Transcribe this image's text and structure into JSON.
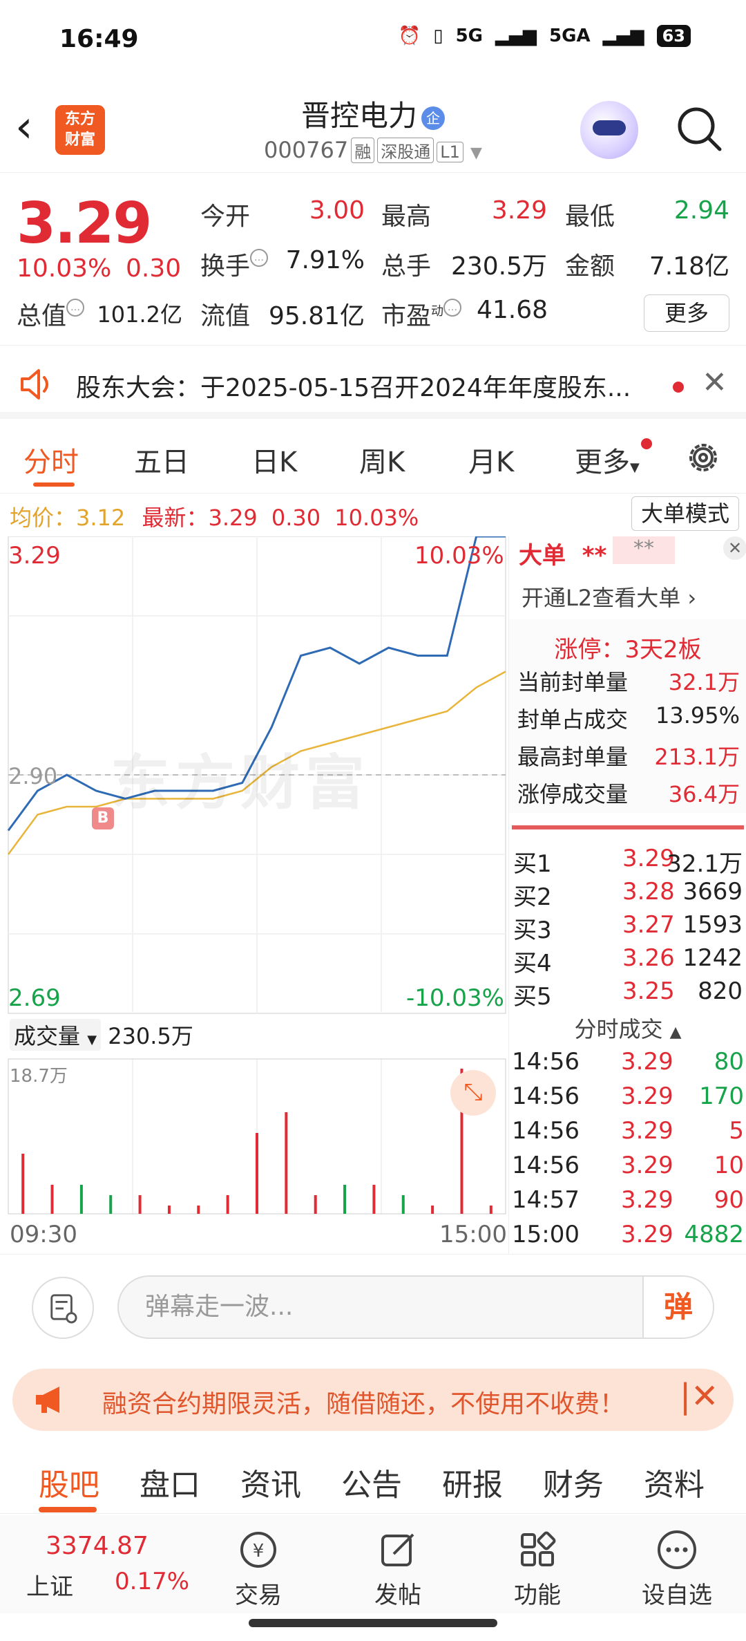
{
  "status_bar": {
    "time": "16:49",
    "network1": "5G",
    "network2": "5GA",
    "battery": "63"
  },
  "header": {
    "brand_logo": "东方财富",
    "stock_name": "晋控电力",
    "name_badge": "企",
    "stock_code": "000767",
    "tags": [
      "融",
      "深股通",
      "L1"
    ]
  },
  "quote": {
    "price": "3.29",
    "change_pct": "10.03%",
    "change": "0.30",
    "open_label": "今开",
    "open": "3.00",
    "high_label": "最高",
    "high": "3.29",
    "low_label": "最低",
    "low": "2.94",
    "turnover_label": "换手",
    "turnover": "7.91%",
    "volume_label": "总手",
    "volume": "230.5万",
    "amount_label": "金额",
    "amount": "7.18亿",
    "mktcap_label": "总值",
    "mktcap": "101.2亿",
    "float_label": "流值",
    "float_cap": "95.81亿",
    "pe_label": "市盈",
    "pe_sup": "动",
    "pe": "41.68",
    "more_label": "更多"
  },
  "notice": {
    "text": "股东大会：于2025-05-15召开2024年年度股东..."
  },
  "chart_tabs": [
    "分时",
    "五日",
    "日K",
    "周K",
    "月K",
    "更多"
  ],
  "avg_line": {
    "avg_label": "均价：",
    "avg": "3.12",
    "latest_label": "最新：",
    "latest": "3.29",
    "change": "0.30",
    "pct": "10.03%",
    "mode_button": "大单模式"
  },
  "chart_labels": {
    "high": "3.29",
    "high_pct": "10.03%",
    "mid": "2.90",
    "low": "2.69",
    "low_pct": "-10.03%",
    "buy_marker": "B",
    "watermark": "东方财富",
    "volume_select": "成交量",
    "volume_total": "230.5万",
    "volume_max": "18.7万",
    "time_start": "09:30",
    "time_end": "15:00"
  },
  "chart_data": {
    "type": "line",
    "title": "",
    "xlabel": "",
    "ylabel": "",
    "ylim": [
      2.69,
      3.29
    ],
    "x": [
      "09:30",
      "09:45",
      "10:00",
      "10:15",
      "10:30",
      "10:45",
      "11:00",
      "11:15",
      "11:30",
      "13:00",
      "13:15",
      "13:30",
      "13:45",
      "14:00",
      "14:15",
      "14:30",
      "14:45",
      "15:00"
    ],
    "series": [
      {
        "name": "price",
        "values": [
          2.92,
          2.97,
          2.99,
          2.97,
          2.96,
          2.97,
          2.97,
          2.97,
          2.98,
          3.05,
          3.14,
          3.15,
          3.13,
          3.15,
          3.14,
          3.14,
          3.29,
          3.29
        ]
      },
      {
        "name": "均价",
        "values": [
          2.89,
          2.94,
          2.95,
          2.95,
          2.96,
          2.96,
          2.96,
          2.96,
          2.97,
          3.0,
          3.02,
          3.03,
          3.04,
          3.05,
          3.06,
          3.07,
          3.1,
          3.12
        ]
      }
    ],
    "volume_peak_label": "18.7万"
  },
  "right_panel": {
    "big_order_title": "大单",
    "stars1": "**",
    "stars2": "**",
    "l2_link": "开通L2查看大单",
    "limit_status": "涨停：3天2板",
    "seal_rows": [
      {
        "label": "当前封单量",
        "value": "32.1万"
      },
      {
        "label": "封单占成交",
        "value": "13.95%"
      },
      {
        "label": "最高封单量",
        "value": "213.1万"
      },
      {
        "label": "涨停成交量",
        "value": "36.4万"
      }
    ],
    "bids": [
      {
        "label": "买1",
        "price": "3.29",
        "volume": "32.1万"
      },
      {
        "label": "买2",
        "price": "3.28",
        "volume": "3669"
      },
      {
        "label": "买3",
        "price": "3.27",
        "volume": "1593"
      },
      {
        "label": "买4",
        "price": "3.26",
        "volume": "1242"
      },
      {
        "label": "买5",
        "price": "3.25",
        "volume": "820"
      }
    ],
    "trade_title": "分时成交",
    "trades": [
      {
        "time": "14:56",
        "price": "3.29",
        "volume": "80"
      },
      {
        "time": "14:56",
        "price": "3.29",
        "volume": "170"
      },
      {
        "time": "14:56",
        "price": "3.29",
        "volume": "5"
      },
      {
        "time": "14:56",
        "price": "3.29",
        "volume": "10"
      },
      {
        "time": "14:57",
        "price": "3.29",
        "volume": "90"
      },
      {
        "time": "15:00",
        "price": "3.29",
        "volume": "4882"
      }
    ]
  },
  "danmaku": {
    "placeholder": "弹幕走一波...",
    "send": "弹"
  },
  "promo": {
    "text": "融资合约期限灵活，随借随还，不使用不收费！"
  },
  "bottom_tabs": [
    "股吧",
    "盘口",
    "资讯",
    "公告",
    "研报",
    "财务",
    "资料"
  ],
  "bottom_nav": {
    "index_value": "3374.87",
    "index_name": "上证",
    "index_pct": "0.17%",
    "items": [
      "交易",
      "发帖",
      "功能",
      "设自选"
    ]
  }
}
